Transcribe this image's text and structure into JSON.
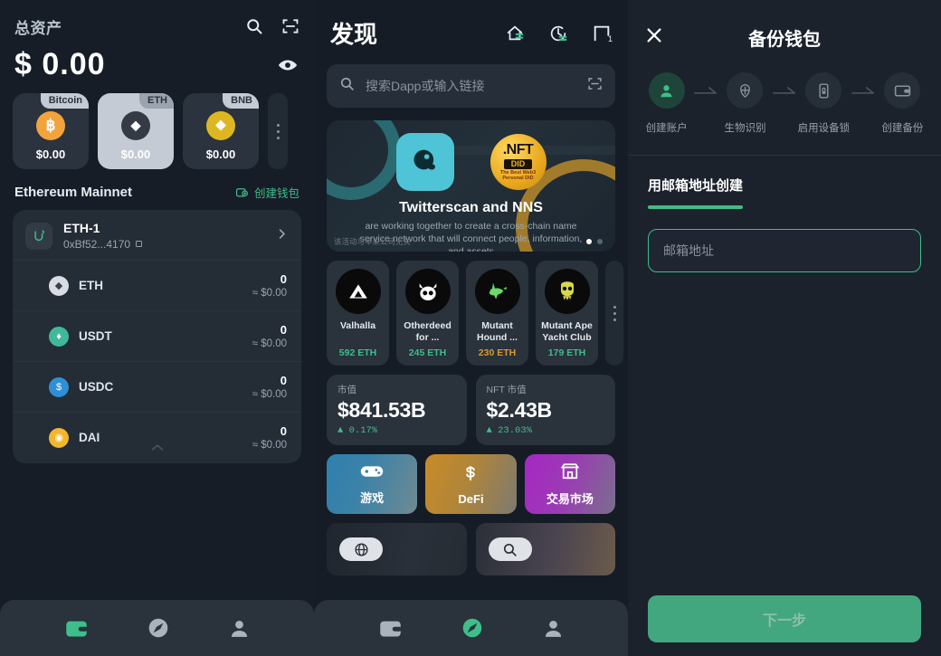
{
  "wallet": {
    "header": {
      "title": "总资产",
      "search_icon": "search-icon",
      "scan_icon": "scan-icon"
    },
    "balance": "$ 0.00",
    "eye_icon": "eye-icon",
    "coins": [
      {
        "tag": "Bitcoin",
        "symbol": "B",
        "amount": "$0.00",
        "color": "#f2a33c",
        "selected": false
      },
      {
        "tag": "ETH",
        "symbol": "◆",
        "amount": "$0.00",
        "color": "#343b45",
        "selected": true
      },
      {
        "tag": "BNB",
        "symbol": "❖",
        "amount": "$0.00",
        "color": "#ddb723",
        "selected": false
      }
    ],
    "network": "Ethereum Mainnet",
    "create_wallet": "创建钱包",
    "account": {
      "name": "ETH-1",
      "address": "0xBf52...4170",
      "copy_icon": "copy-icon",
      "chevron_icon": "chevron-right-icon"
    },
    "tokens": [
      {
        "name": "ETH",
        "amount": "0",
        "usd": "≈ $0.00",
        "color": "#d9dde2",
        "glyph": "◆"
      },
      {
        "name": "USDT",
        "amount": "0",
        "usd": "≈ $0.00",
        "color": "#3fb999",
        "glyph": "♦"
      },
      {
        "name": "USDC",
        "amount": "0",
        "usd": "≈ $0.00",
        "color": "#2f8fd6",
        "glyph": "$"
      },
      {
        "name": "DAI",
        "amount": "0",
        "usd": "≈ $0.00",
        "color": "#f2b72e",
        "glyph": "◉"
      }
    ],
    "nav": [
      {
        "name": "wallet-icon",
        "active": true
      },
      {
        "name": "discover-icon",
        "active": false
      },
      {
        "name": "profile-icon",
        "active": false
      }
    ]
  },
  "discover": {
    "title": "发现",
    "header_icons": [
      "home-icon",
      "history-icon",
      "tabs-icon"
    ],
    "tabs_count": "1",
    "search": {
      "placeholder": "搜索Dapp或输入链接",
      "search_icon": "search-icon",
      "scan_icon": "scan-icon"
    },
    "banner": {
      "title": "Twitterscan and NNS",
      "subtitle": "are working together to create a cross-chain name service network that will connect people, information, and assets",
      "disclaimer": "该活动与苹果公司无关",
      "nft_badge": {
        "line1": ".NFT",
        "line2": "DID",
        "line3": "The Best Web3 Personal DID"
      }
    },
    "nfts": [
      {
        "name": "Valhalla",
        "price": "592 ETH",
        "color": "#3fbd8a",
        "glyph": "▲"
      },
      {
        "name": "Otherdeed for ...",
        "price": "245 ETH",
        "color": "#3fbd8a",
        "glyph": "☢"
      },
      {
        "name": "Mutant Hound ...",
        "price": "230 ETH",
        "color": "#d99b2a",
        "glyph": "ᾘE"
      },
      {
        "name": "Mutant Ape Yacht Club",
        "price": "179 ETH",
        "color": "#3fbd8a",
        "glyph": "☠"
      }
    ],
    "stats": [
      {
        "label": "市值",
        "value": "$841.53B",
        "change": "▲ 0.17%"
      },
      {
        "label": "NFT 市值",
        "value": "$2.43B",
        "change": "▲ 23.03%"
      }
    ],
    "categories": [
      {
        "label": "游戏",
        "icon": "gamepad-icon"
      },
      {
        "label": "DeFi",
        "icon": "dollar-icon"
      },
      {
        "label": "交易市场",
        "icon": "marketplace-icon"
      }
    ],
    "tiles": [
      {
        "icon": "globe-icon"
      },
      {
        "icon": "search-icon"
      }
    ],
    "nav": [
      {
        "name": "wallet-icon",
        "active": false
      },
      {
        "name": "discover-icon",
        "active": true
      },
      {
        "name": "profile-icon",
        "active": false
      }
    ]
  },
  "backup": {
    "title": "备份钱包",
    "close_icon": "close-icon",
    "steps": [
      {
        "label": "创建账户",
        "icon": "person-icon",
        "active": true
      },
      {
        "label": "生物识别",
        "icon": "fingerprint-icon",
        "active": false
      },
      {
        "label": "启用设备锁",
        "icon": "device-lock-icon",
        "active": false
      },
      {
        "label": "创建备份",
        "icon": "wallet-card-icon",
        "active": false
      }
    ],
    "section_title": "用邮箱地址创建",
    "email_placeholder": "邮箱地址",
    "email_value": "",
    "next_label": "下一步"
  },
  "colors": {
    "accent_green": "#3fbd8a",
    "button_green": "#42a77f",
    "panel_bg": "#161d27",
    "card_bg": "#2a323c"
  }
}
